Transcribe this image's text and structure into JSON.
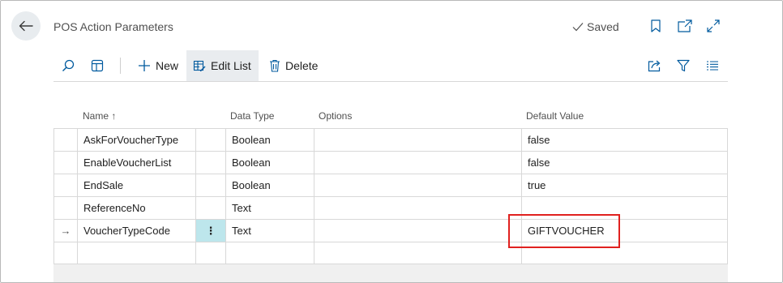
{
  "header": {
    "title": "POS Action Parameters",
    "status": "Saved"
  },
  "actionbar": {
    "new_label": "New",
    "edit_list_label": "Edit List",
    "delete_label": "Delete"
  },
  "columns": {
    "name": "Name",
    "sort_indicator": "↑",
    "data_type": "Data Type",
    "options": "Options",
    "default_value": "Default Value"
  },
  "rows": [
    {
      "indicator": "",
      "name": "AskForVoucherType",
      "data_type": "Boolean",
      "options": "",
      "default_value": "false"
    },
    {
      "indicator": "",
      "name": "EnableVoucherList",
      "data_type": "Boolean",
      "options": "",
      "default_value": "false"
    },
    {
      "indicator": "",
      "name": "EndSale",
      "data_type": "Boolean",
      "options": "",
      "default_value": "true"
    },
    {
      "indicator": "",
      "name": "ReferenceNo",
      "data_type": "Text",
      "options": "",
      "default_value": ""
    },
    {
      "indicator": "→",
      "name": "VoucherTypeCode",
      "menu": "⋮",
      "data_type": "Text",
      "options": "",
      "default_value": "GIFTVOUCHER"
    },
    {
      "indicator": "",
      "name": "",
      "data_type": "",
      "options": "",
      "default_value": ""
    }
  ],
  "colors": {
    "accent": "#005a9e",
    "highlight_box": "#e0211f",
    "selected_cell": "#bde6ec"
  }
}
